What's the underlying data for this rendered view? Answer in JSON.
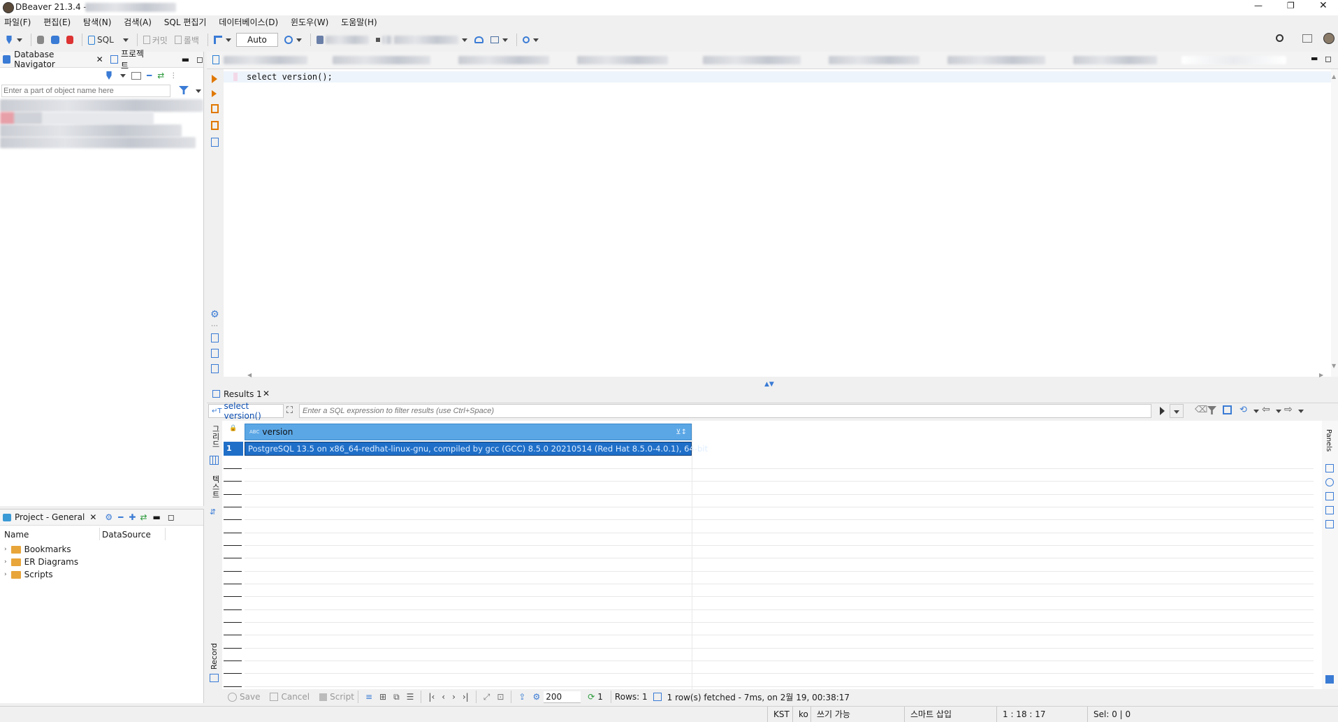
{
  "window": {
    "title": "DBeaver 21.3.4 -",
    "controls": [
      "—",
      "❐",
      "✕"
    ]
  },
  "menu": [
    "파일(F)",
    "편집(E)",
    "탐색(N)",
    "검색(A)",
    "SQL 편집기",
    "데이터베이스(D)",
    "윈도우(W)",
    "도움말(H)"
  ],
  "toolbar": {
    "sql_label": "SQL",
    "commit_label": "커밋",
    "rollback_label": "롤백",
    "auto_value": "Auto"
  },
  "navigator": {
    "tab_db": "Database Navigator",
    "tab_project": "프로젝트",
    "filter_placeholder": "Enter a part of object name here"
  },
  "project_panel": {
    "title": "Project - General",
    "col_name": "Name",
    "col_datasource": "DataSource",
    "items": [
      "Bookmarks",
      "ER Diagrams",
      "Scripts"
    ]
  },
  "editor": {
    "code": "select version();"
  },
  "results": {
    "tab_label": "Results 1",
    "query_label": "select version()",
    "filter_placeholder": "Enter a SQL expression to filter results (use Ctrl+Space)",
    "column_type": "ABC",
    "column_name": "version",
    "row_number": "1",
    "row_value": "PostgreSQL 13.5 on x86_64-redhat-linux-gnu, compiled by gcc (GCC) 8.5.0 20210514 (Red Hat 8.5.0-4.0.1), 64-bit",
    "side_grid": "그리드",
    "side_text": "텍스트",
    "side_record": "Record",
    "panels_label": "Panels"
  },
  "results_footer": {
    "save": "Save",
    "cancel": "Cancel",
    "script": "Script",
    "fetch_size": "200",
    "refresh_count": "1",
    "rows": "Rows: 1",
    "fetched": "1 row(s) fetched - 7ms, on 2월 19, 00:38:17"
  },
  "statusbar": {
    "timezone": "KST",
    "locale": "ko",
    "mode": "쓰기 가능",
    "insert_mode": "스마트 삽입",
    "position": "1 : 18 : 17",
    "selection": "Sel: 0 | 0"
  },
  "colors": {
    "accent": "#2a7fd4",
    "header_selected": "#5ba7e6",
    "row_selected": "#1f6fc8"
  }
}
